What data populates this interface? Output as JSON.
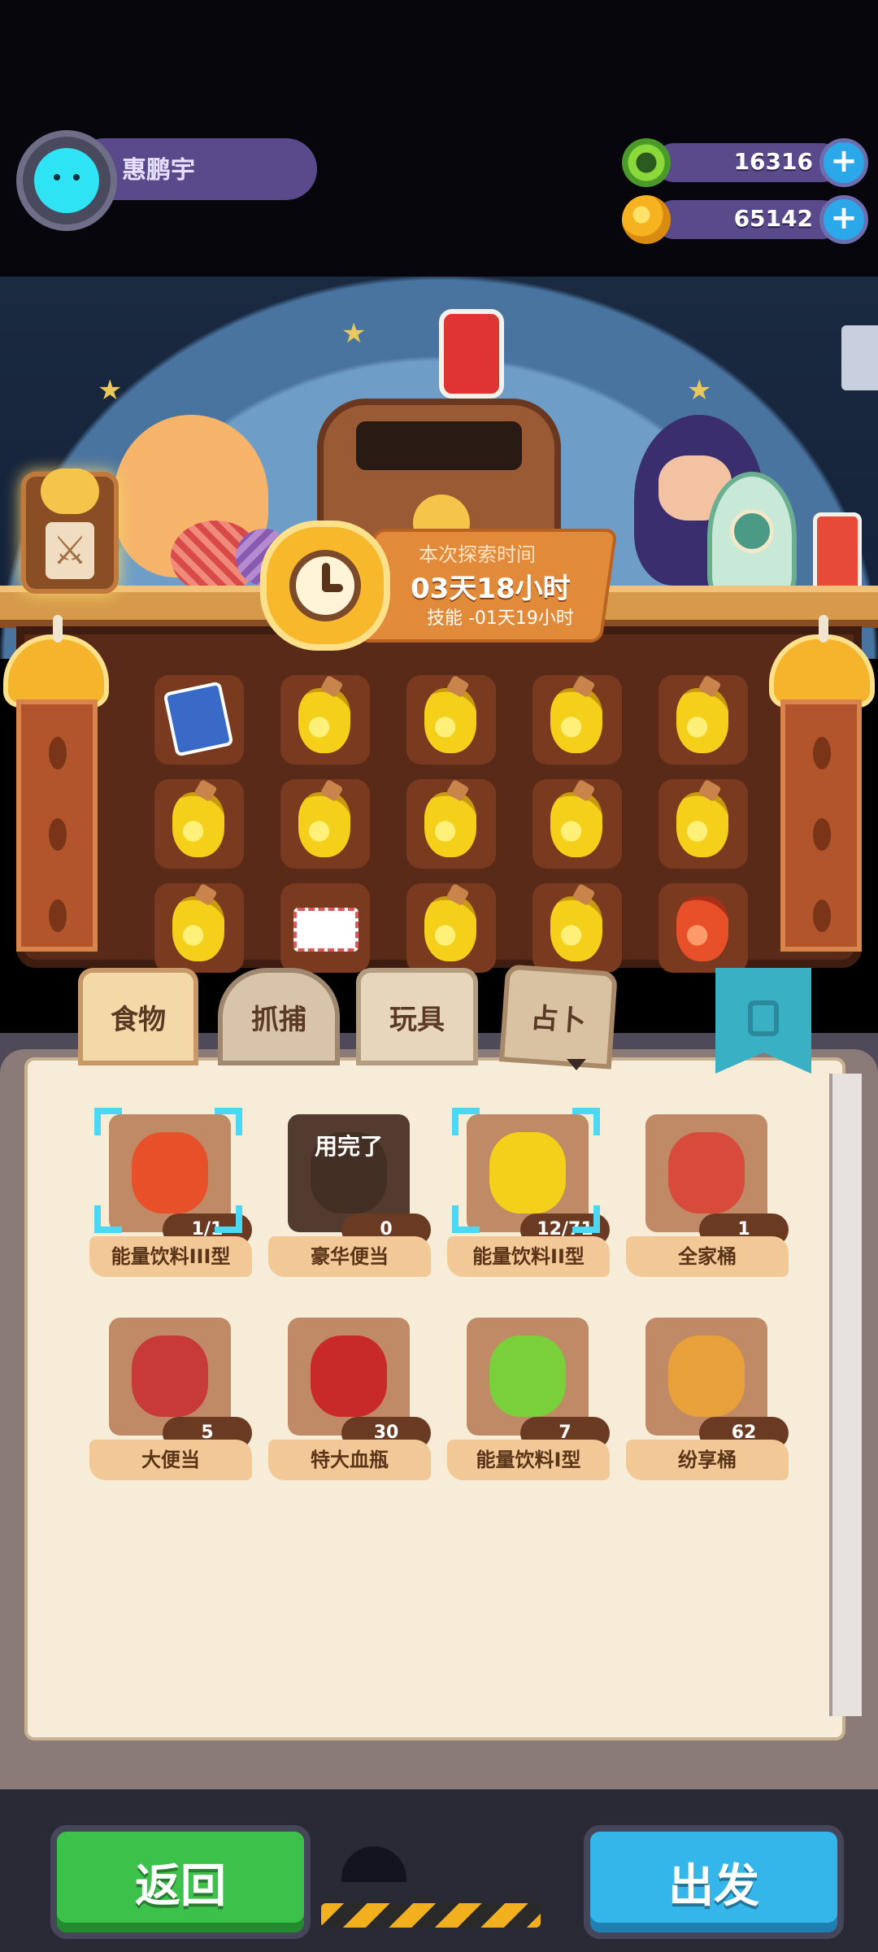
{
  "player": {
    "name": "惠鹏宇"
  },
  "currencies": [
    {
      "icon": "green-gem-icon",
      "value": "16316"
    },
    {
      "icon": "gold-coin-icon",
      "value": "65142"
    }
  ],
  "plus_label": "+",
  "timer": {
    "label": "本次探索时间",
    "time": "03天18小时",
    "skill": "技能 -01天19小时"
  },
  "inventory_grid": [
    [
      "card",
      "yellow-bottle",
      "yellow-bottle",
      "yellow-bottle",
      "yellow-bottle"
    ],
    [
      "yellow-bottle",
      "yellow-bottle",
      "yellow-bottle",
      "yellow-bottle",
      "yellow-bottle"
    ],
    [
      "yellow-bottle",
      "letter",
      "yellow-bottle",
      "yellow-bottle",
      "red-bottle"
    ]
  ],
  "tabs": [
    {
      "label": "食物",
      "active": false
    },
    {
      "label": "抓捕",
      "active": false
    },
    {
      "label": "玩具",
      "active": false
    },
    {
      "label": "占卜",
      "active": true
    }
  ],
  "items": [
    {
      "name": "能量饮料III型",
      "count": "1/1",
      "selected": true,
      "used_up": false,
      "color": "#e8502a"
    },
    {
      "name": "豪华便当",
      "count": "0",
      "selected": false,
      "used_up": true,
      "used_label": "用完了",
      "color": "#8a5a3a"
    },
    {
      "name": "能量饮料II型",
      "count": "12/71",
      "selected": true,
      "used_up": false,
      "color": "#f5d01a"
    },
    {
      "name": "全家桶",
      "count": "1",
      "selected": false,
      "used_up": false,
      "color": "#d84a3a"
    },
    {
      "name": "大便当",
      "count": "5",
      "selected": false,
      "used_up": false,
      "color": "#c83a3a"
    },
    {
      "name": "特大血瓶",
      "count": "30",
      "selected": false,
      "used_up": false,
      "color": "#c82a2a"
    },
    {
      "name": "能量饮料I型",
      "count": "7",
      "selected": false,
      "used_up": false,
      "color": "#7ad03a"
    },
    {
      "name": "纷享桶",
      "count": "62",
      "selected": false,
      "used_up": false,
      "color": "#e8a03a"
    }
  ],
  "buttons": {
    "back": "返回",
    "go": "出发"
  }
}
